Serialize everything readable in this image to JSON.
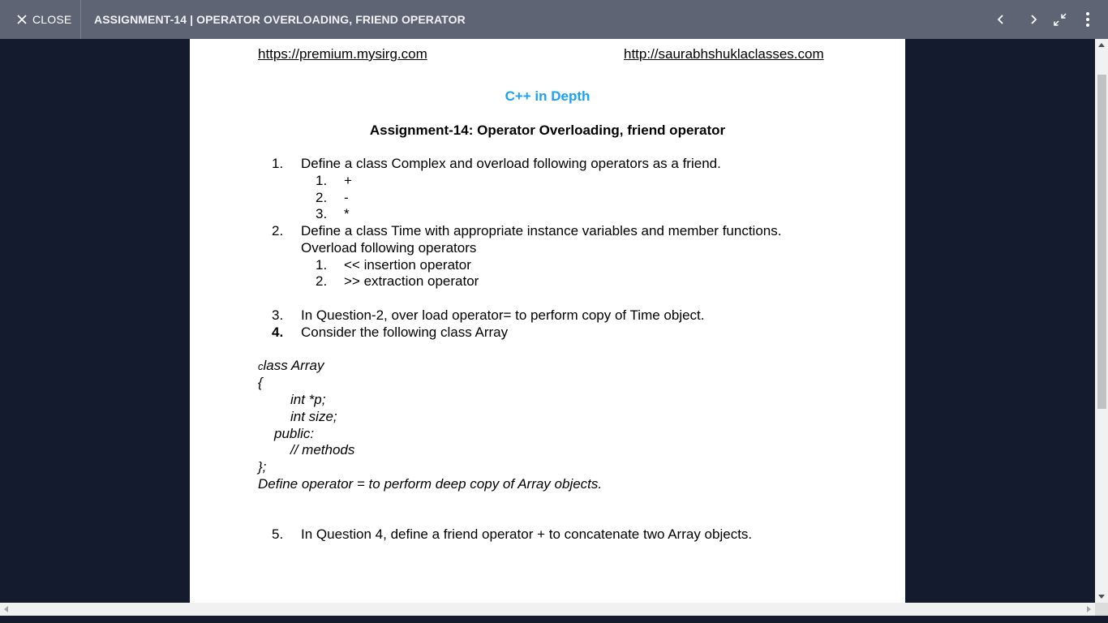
{
  "topbar": {
    "close_label": "CLOSE",
    "title": "ASSIGNMENT-14 | OPERATOR OVERLOADING, FRIEND OPERATOR",
    "icons": [
      "close-icon",
      "chevron-left-icon",
      "chevron-right-icon",
      "exit-fullscreen-icon",
      "more-vertical-icon"
    ]
  },
  "document": {
    "link_left": "https://premium.mysirg.com",
    "link_right": "http://saurabhshuklaclasses.com",
    "heading": "C++ in Depth",
    "title": "Assignment-14: Operator Overloading, friend operator",
    "q1": {
      "num": "1.",
      "text": "Define a class Complex and overload following operators as a friend.",
      "sub": [
        {
          "num": "1.",
          "text": "+"
        },
        {
          "num": "2.",
          "text": "-"
        },
        {
          "num": "3.",
          "text": "*"
        }
      ]
    },
    "q2": {
      "num": "2.",
      "text_line1": "Define a class Time with appropriate instance variables and member functions.",
      "text_line2": "Overload following operators",
      "sub": [
        {
          "num": "1.",
          "text": "<< insertion operator"
        },
        {
          "num": "2.",
          "text": ">> extraction operator"
        }
      ]
    },
    "q3": {
      "num": "3.",
      "text": "In Question-2, over load operator= to perform copy of Time object."
    },
    "q4": {
      "num": "4.",
      "text": "Consider the following class Array"
    },
    "code": {
      "line1_first": "c",
      "line1_rest": "lass Array",
      "line2": "{",
      "line3": "int *p;",
      "line4": "int size;",
      "line5": "public:",
      "line6": "// methods",
      "line7": "};",
      "line8": "Define operator = to perform deep copy of Array objects."
    },
    "q5": {
      "num": "5.",
      "text": "In Question 4, define a friend operator + to concatenate two Array objects."
    }
  },
  "colors": {
    "topbar_bg": "#5e6473",
    "background": "#141b2f",
    "heading_blue": "#1da1f2",
    "page_bg": "#ffffff"
  }
}
